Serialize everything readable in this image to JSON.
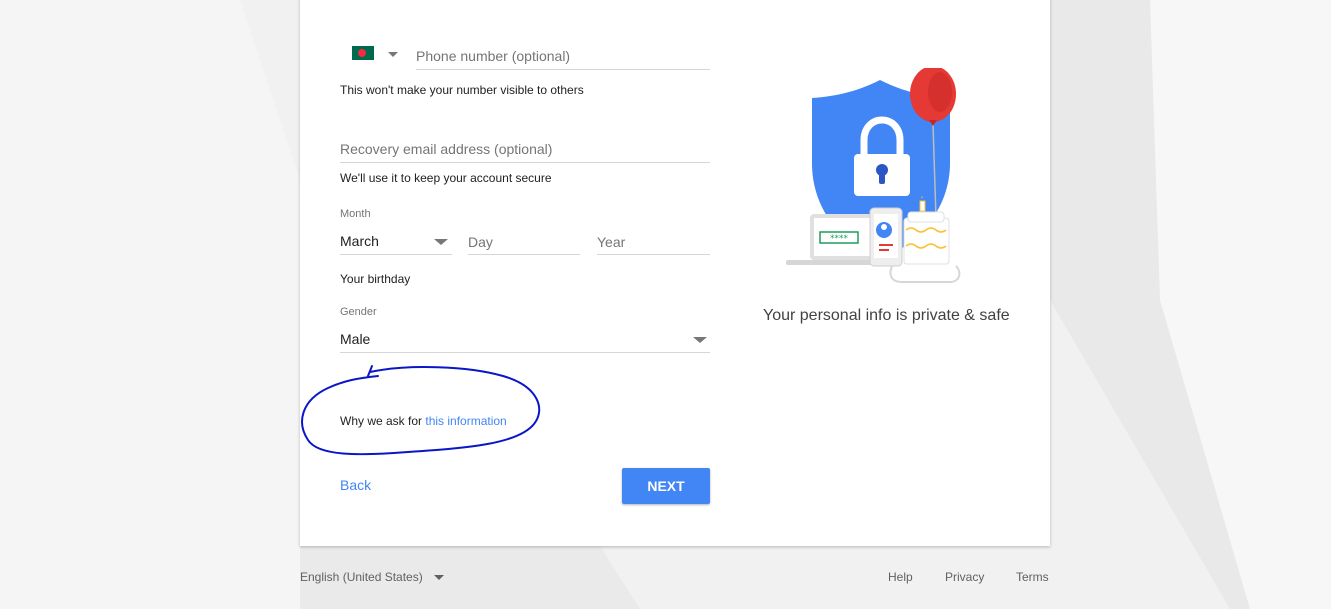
{
  "phone": {
    "country_flag": "bangladesh-flag",
    "placeholder": "Phone number (optional)",
    "helper": "This won't make your number visible to others"
  },
  "recovery_email": {
    "placeholder": "Recovery email address (optional)",
    "helper": "We'll use it to keep your account secure"
  },
  "birthday": {
    "month_label": "Month",
    "month_value": "March",
    "day_placeholder": "Day",
    "year_placeholder": "Year",
    "helper": "Your birthday"
  },
  "gender": {
    "label": "Gender",
    "value": "Male"
  },
  "why": {
    "prefix": "Why we ask for ",
    "link": "this information"
  },
  "actions": {
    "back": "Back",
    "next": "NEXT"
  },
  "illustration": {
    "caption": "Your personal info is private & safe",
    "screen_text": "****"
  },
  "footer": {
    "language": "English (United States)",
    "help": "Help",
    "privacy": "Privacy",
    "terms": "Terms"
  },
  "colors": {
    "accent": "#4285f4",
    "annotation": "#0a16c8",
    "balloon": "#e53935",
    "shield": "#4285f4"
  }
}
